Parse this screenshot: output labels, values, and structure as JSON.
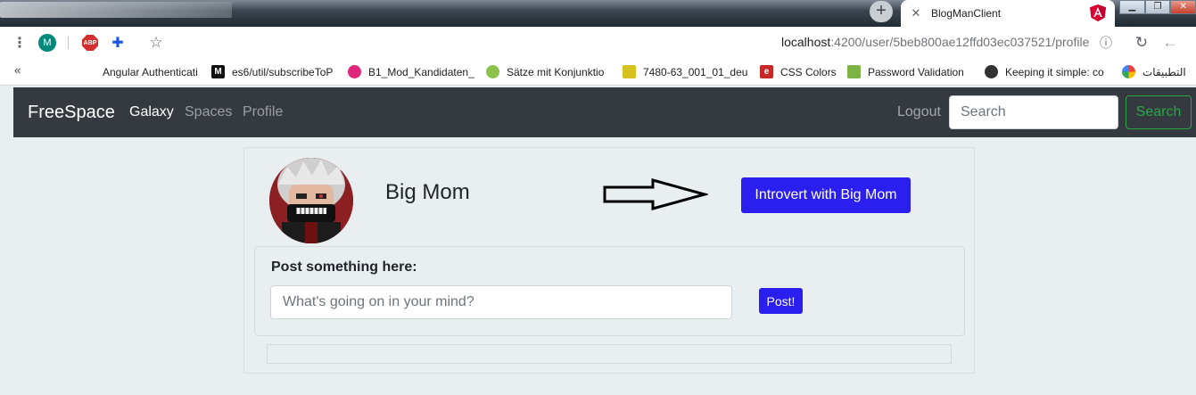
{
  "browser": {
    "tab_title": "BlogManClient",
    "new_tab_glyph": "+",
    "url_host": "localhost",
    "url_path": ":4200/user/5beb800ae12ffd03ec037521/profile",
    "profile_initial": "M",
    "abp_label": "ABP",
    "icons": [
      "menu-icon",
      "profile-icon",
      "adblock-icon",
      "extensions-icon",
      "bookmark-star-icon",
      "site-info-icon",
      "reload-icon",
      "back-icon"
    ],
    "bookmarks_more": "«",
    "bookmarks": [
      {
        "label": "Angular Authenticati",
        "icon": "bookmark-icon"
      },
      {
        "label": "es6/util/subscribeToP",
        "icon": "medium-icon"
      },
      {
        "label": "B1_Mod_Kandidaten_",
        "icon": "bookmark-icon"
      },
      {
        "label": "Sätze mit Konjunktio",
        "icon": "bookmark-icon"
      },
      {
        "label": "7480-63_001_01_deu",
        "icon": "bookmark-icon"
      },
      {
        "label": "CSS Colors",
        "icon": "bookmark-icon"
      },
      {
        "label": "Password Validation",
        "icon": "bookmark-icon"
      },
      {
        "label": "Keeping it simple: co",
        "icon": "linux-icon"
      },
      {
        "label": "التطبيقات",
        "icon": "apps-icon"
      }
    ]
  },
  "navbar": {
    "brand": "FreeSpace",
    "links": [
      {
        "label": "Galaxy",
        "active": true
      },
      {
        "label": "Spaces",
        "active": false
      },
      {
        "label": "Profile",
        "active": false
      }
    ],
    "logout": "Logout",
    "search_placeholder": "Search",
    "search_button": "Search"
  },
  "profile": {
    "name": "Big Mom",
    "action_button": "Introvert with Big Mom"
  },
  "post": {
    "label": "Post something here:",
    "placeholder": "What's going on in your mind?",
    "button": "Post!"
  },
  "colors": {
    "primary": "#2b1ff0",
    "navbar_bg": "#343a40",
    "success": "#28a745",
    "page_bg": "#e9eff0"
  }
}
